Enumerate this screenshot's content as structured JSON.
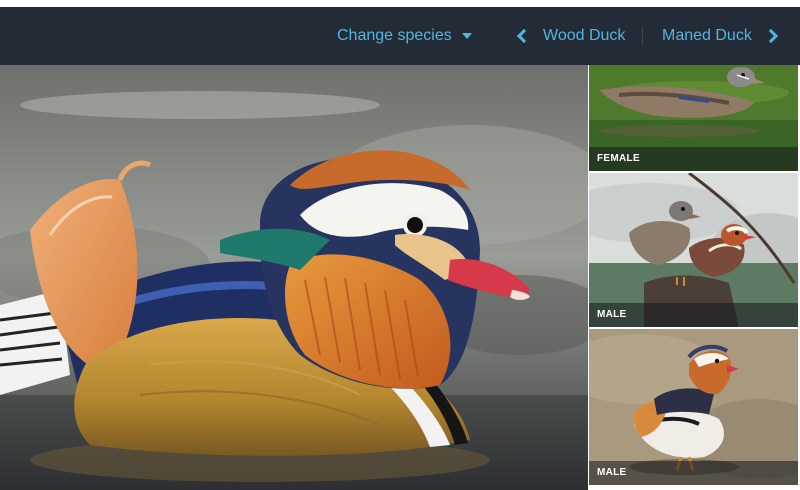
{
  "nav": {
    "change_species": "Change species",
    "prev_species": "Wood Duck",
    "next_species": "Maned Duck"
  },
  "icons": {
    "dropdown": "caret-down-icon",
    "prev": "chevron-left-icon",
    "next": "chevron-right-icon"
  },
  "colors": {
    "nav_background": "#232b36",
    "nav_link": "#4fb6e3"
  },
  "gallery": {
    "thumbnails": [
      {
        "label": "FEMALE"
      },
      {
        "label": "MALE"
      },
      {
        "label": "MALE"
      }
    ]
  }
}
